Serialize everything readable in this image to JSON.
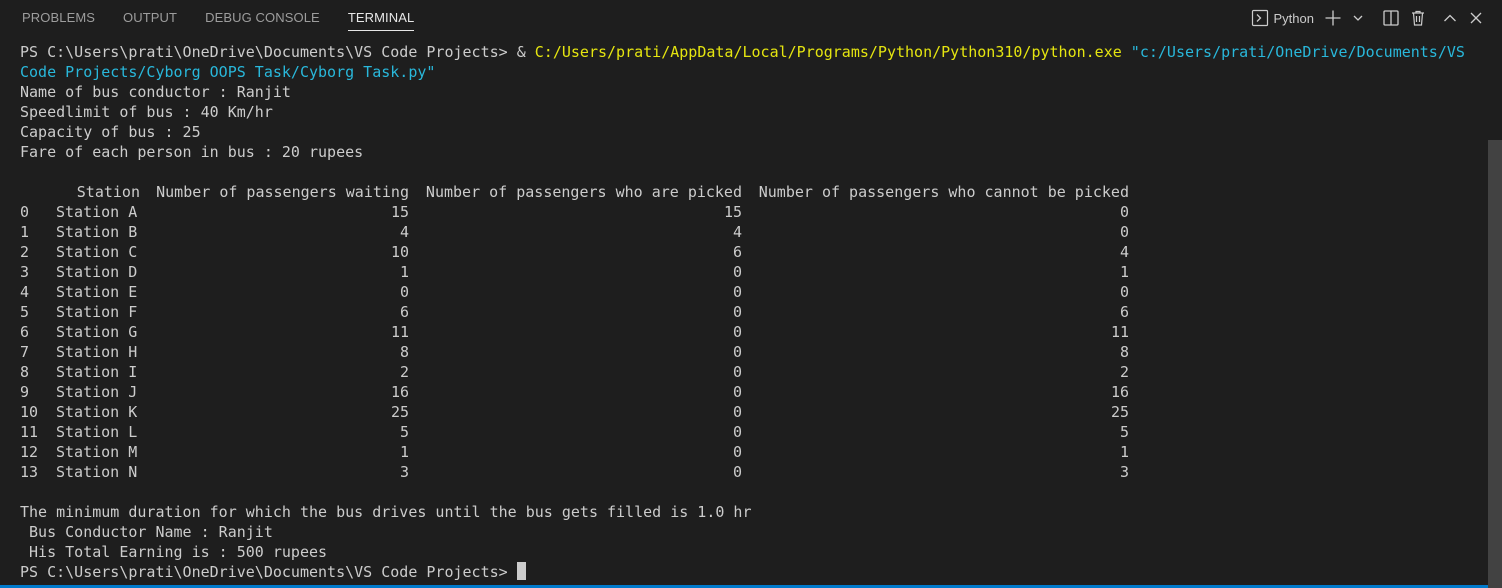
{
  "panel": {
    "tabs": [
      "PROBLEMS",
      "OUTPUT",
      "DEBUG CONSOLE",
      "TERMINAL"
    ],
    "shell_name": "Python",
    "icons": [
      "terminal-icon",
      "plus-icon",
      "chevron-down-icon",
      "split-icon",
      "trash-icon",
      "chevron-up-icon",
      "close-icon"
    ],
    "accent_color": "#007acc"
  },
  "terminal": {
    "cmd_prompt": "PS C:\\Users\\prati\\OneDrive\\Documents\\VS Code Projects> & ",
    "cmd_exe": "C:/Users/prati/AppData/Local/Programs/Python/Python310/python.exe",
    "cmd_arg_line1": "\"c:/Users/prati/OneDrive/Documents/VS",
    "cmd_arg_line2": "Code Projects/Cyborg OOPS Task/Cyborg Task.py\"",
    "info": [
      "Name of bus conductor : Ranjit",
      "Speedlimit of bus : 40 Km/hr",
      "Capacity of bus : 25",
      "Fare of each person in bus : 20 rupees"
    ],
    "table": {
      "headers": [
        "Station",
        "Number of passengers waiting",
        "Number of passengers who are picked",
        "Number of passengers who cannot be picked"
      ],
      "rows": [
        [
          "0",
          "Station A",
          "15",
          "15",
          "0"
        ],
        [
          "1",
          "Station B",
          "4",
          "4",
          "0"
        ],
        [
          "2",
          "Station C",
          "10",
          "6",
          "4"
        ],
        [
          "3",
          "Station D",
          "1",
          "0",
          "1"
        ],
        [
          "4",
          "Station E",
          "0",
          "0",
          "0"
        ],
        [
          "5",
          "Station F",
          "6",
          "0",
          "6"
        ],
        [
          "6",
          "Station G",
          "11",
          "0",
          "11"
        ],
        [
          "7",
          "Station H",
          "8",
          "0",
          "8"
        ],
        [
          "8",
          "Station I",
          "2",
          "0",
          "2"
        ],
        [
          "9",
          "Station J",
          "16",
          "0",
          "16"
        ],
        [
          "10",
          "Station K",
          "25",
          "0",
          "25"
        ],
        [
          "11",
          "Station L",
          "5",
          "0",
          "5"
        ],
        [
          "12",
          "Station M",
          "1",
          "0",
          "1"
        ],
        [
          "13",
          "Station N",
          "3",
          "0",
          "3"
        ]
      ]
    },
    "summary": [
      "The minimum duration for which the bus drives until the bus gets filled is 1.0 hr",
      " Bus Conductor Name : Ranjit",
      " His Total Earning is : 500 rupees"
    ],
    "final_prompt": "PS C:\\Users\\prati\\OneDrive\\Documents\\VS Code Projects> "
  }
}
